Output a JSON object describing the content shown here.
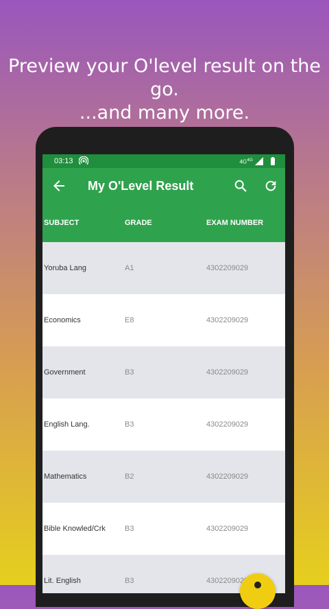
{
  "headline": {
    "line1": "Preview your O'level result on the go.",
    "line2": "...and many more."
  },
  "status_bar": {
    "time": "03:13",
    "network": "4G",
    "network_sup": "4G"
  },
  "app_bar": {
    "title": "My O'Level Result",
    "icons": [
      "back-arrow-icon",
      "search-icon",
      "refresh-icon"
    ]
  },
  "table": {
    "headers": [
      "SUBJECT",
      "GRADE",
      "EXAM NUMBER"
    ],
    "rows": [
      {
        "subject": "Yoruba Lang",
        "grade": "A1",
        "exam_number": "4302209029"
      },
      {
        "subject": "Economics",
        "grade": "E8",
        "exam_number": "4302209029"
      },
      {
        "subject": "Government",
        "grade": "B3",
        "exam_number": "4302209029"
      },
      {
        "subject": "English Lang.",
        "grade": "B3",
        "exam_number": "4302209029"
      },
      {
        "subject": "Mathematics",
        "grade": "B2",
        "exam_number": "4302209029"
      },
      {
        "subject": "Bible Knowled/Crk",
        "grade": "B3",
        "exam_number": "4302209029"
      },
      {
        "subject": "Lit. English",
        "grade": "B3",
        "exam_number": "4302209029"
      }
    ]
  },
  "colors": {
    "primary": "#2fa24d",
    "status_bar": "#1f8e3d",
    "row_alt": "#e3e5ea",
    "fab": "#f1cd12"
  }
}
